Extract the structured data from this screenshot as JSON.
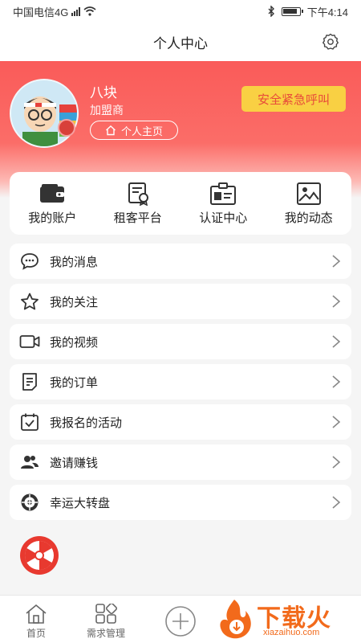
{
  "status_bar": {
    "carrier": "中国电信4G",
    "network_badge": "4G",
    "time": "下午4:14",
    "icons": [
      "signal-icon",
      "wifi-icon",
      "bluetooth-icon",
      "battery-icon"
    ]
  },
  "title_bar": {
    "title": "个人中心",
    "settings_icon": "gear-icon"
  },
  "profile": {
    "name": "八块",
    "role": "加盟商",
    "homepage_label": "个人主页",
    "emergency_label": "安全紧急呼叫"
  },
  "quick_actions": [
    {
      "label": "我的账户",
      "icon": "wallet-icon"
    },
    {
      "label": "租客平台",
      "icon": "certificate-icon"
    },
    {
      "label": "认证中心",
      "icon": "id-card-icon"
    },
    {
      "label": "我的动态",
      "icon": "picture-icon"
    }
  ],
  "menu": [
    {
      "label": "我的消息",
      "icon": "message-icon"
    },
    {
      "label": "我的关注",
      "icon": "star-icon"
    },
    {
      "label": "我的视频",
      "icon": "video-icon"
    },
    {
      "label": "我的订单",
      "icon": "order-icon"
    },
    {
      "label": "我报名的活动",
      "icon": "calendar-check-icon"
    },
    {
      "label": "邀请赚钱",
      "icon": "users-icon"
    },
    {
      "label": "幸运大转盘",
      "icon": "wheel-icon"
    }
  ],
  "tab_bar": [
    {
      "label": "首页",
      "icon": "home-icon"
    },
    {
      "label": "需求管理",
      "icon": "grid-icon"
    },
    {
      "label": "",
      "icon": "plus-icon"
    }
  ],
  "watermark": {
    "text": "下载火",
    "domain": "xiazaihuo.com"
  },
  "colors": {
    "header": "#fa5b59",
    "emergency_bg": "#f9d043",
    "emergency_text": "#e84b3a",
    "watermark": "#f26a1b"
  }
}
